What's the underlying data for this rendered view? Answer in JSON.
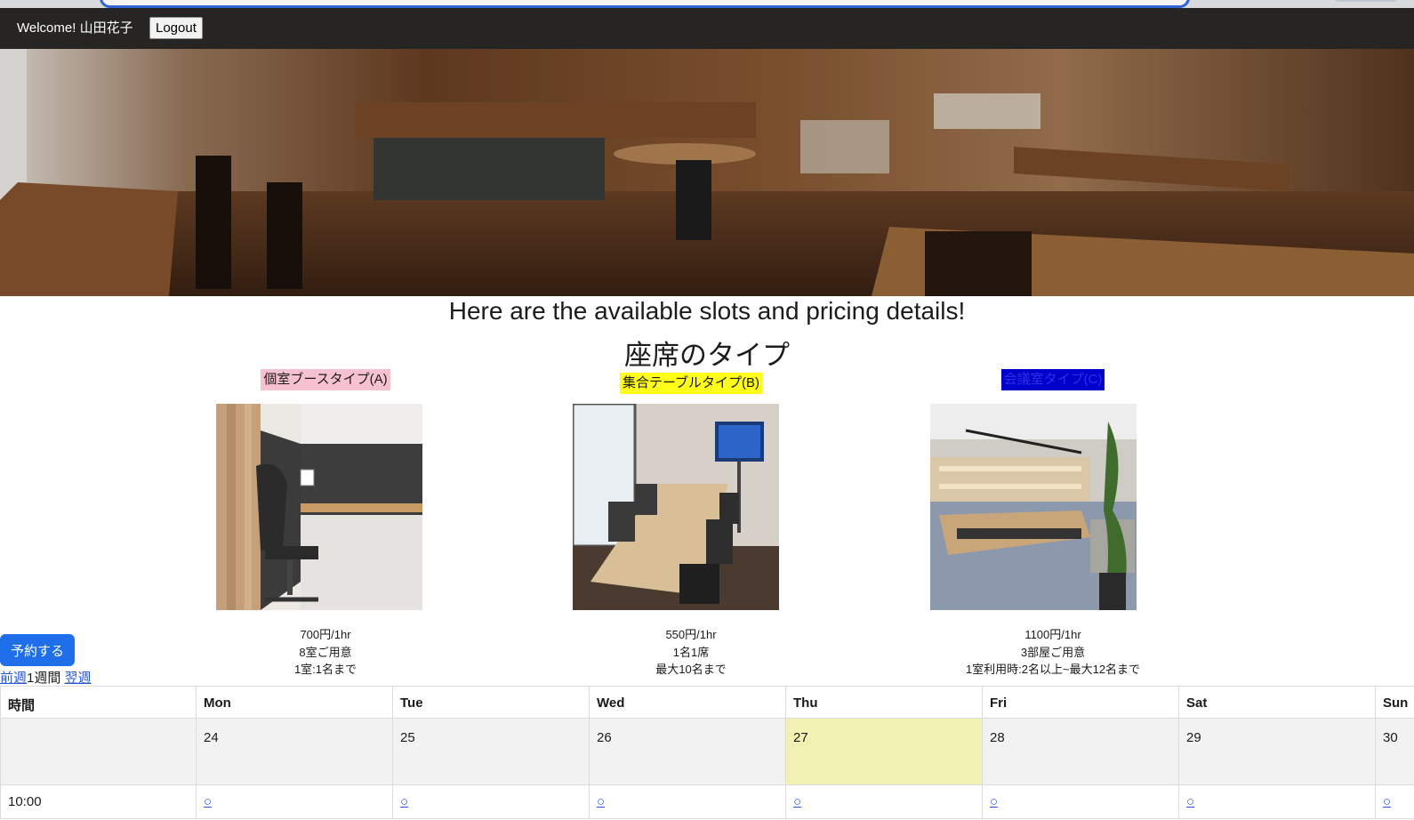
{
  "header": {
    "welcome": "Welcome! 山田花子",
    "logout_label": "Logout"
  },
  "main": {
    "heading": "Here are the available slots and pricing details!",
    "subheading": "座席のタイプ"
  },
  "seat_types": [
    {
      "label": "個室ブースタイプ(A)",
      "label_color": "#f7c2cf",
      "price": "700円/1hr",
      "line2": "8室ご用意",
      "line3": "1室:1名まで"
    },
    {
      "label": "集合テーブルタイプ(B)",
      "label_color": "#ffff1a",
      "price": "550円/1hr",
      "line2": "1名1席",
      "line3": "最大10名まで"
    },
    {
      "label": "会議室タイプ(C)",
      "label_color": "#0000cc",
      "price": "1100円/1hr",
      "line2": "3部屋ご用意",
      "line3": "1室利用時:2名以上~最大12名まで"
    }
  ],
  "reserve_label": "予約する",
  "week_nav": {
    "prev": "前週",
    "current": "1週間",
    "next": "翌週"
  },
  "calendar": {
    "headers": [
      "時間",
      "Mon",
      "Tue",
      "Wed",
      "Thu",
      "Fri",
      "Sat",
      "Sun"
    ],
    "dates": [
      "",
      "24",
      "25",
      "26",
      "27",
      "28",
      "29",
      "30"
    ],
    "today_index": 4,
    "today_color": "#f1f1b4",
    "rows": [
      {
        "time": "10:00",
        "slots": [
          "○",
          "○",
          "○",
          "○",
          "○",
          "○",
          "○"
        ]
      }
    ]
  },
  "colors": {
    "header_bg": "#262523",
    "link": "#2456d6",
    "button": "#1f6feb"
  }
}
